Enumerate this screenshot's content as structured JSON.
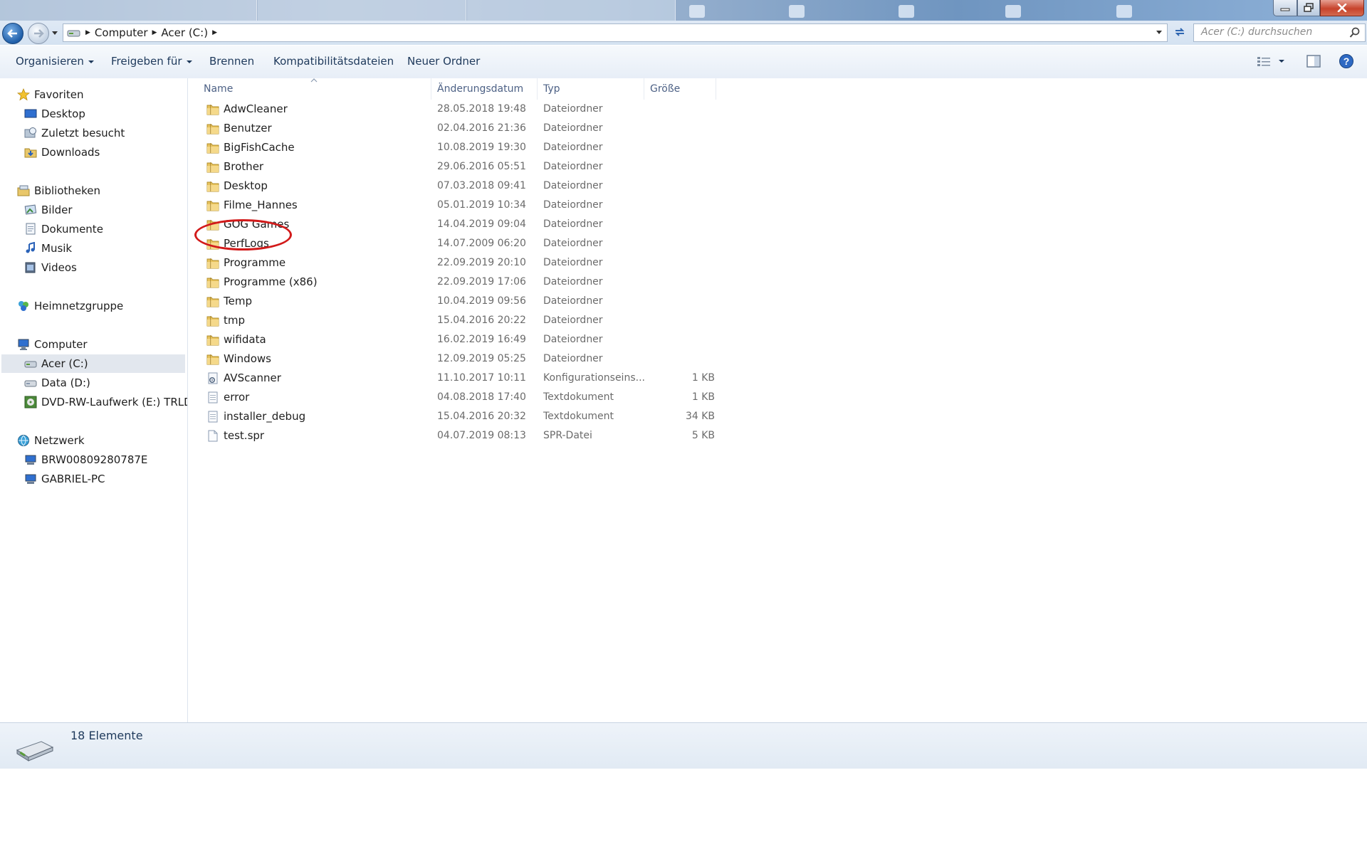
{
  "window": {
    "minimize_icon": "minimize-icon",
    "maximize_icon": "maximize-icon",
    "close_icon": "close-icon"
  },
  "address": {
    "crumbs": [
      "Computer",
      "Acer (C:)"
    ],
    "search_placeholder": "Acer (C:) durchsuchen"
  },
  "toolbar": {
    "organize": "Organisieren",
    "share": "Freigeben für",
    "burn": "Brennen",
    "compat": "Kompatibilitätsdateien",
    "new_folder": "Neuer Ordner"
  },
  "sidebar": {
    "favorites": "Favoriten",
    "fav_items": [
      "Desktop",
      "Zuletzt besucht",
      "Downloads"
    ],
    "libraries": "Bibliotheken",
    "lib_items": [
      "Bilder",
      "Dokumente",
      "Musik",
      "Videos"
    ],
    "homegroup": "Heimnetzgruppe",
    "computer": "Computer",
    "drives": [
      "Acer (C:)",
      "Data (D:)",
      "DVD-RW-Laufwerk (E:) TRLD_D"
    ],
    "network": "Netzwerk",
    "net_items": [
      "BRW00809280787E",
      "GABRIEL-PC"
    ]
  },
  "columns": {
    "name": "Name",
    "date": "Änderungsdatum",
    "type": "Typ",
    "size": "Größe"
  },
  "files": [
    {
      "name": "AdwCleaner",
      "date": "28.05.2018 19:48",
      "type": "Dateiordner",
      "size": "",
      "icon": "folder-icon"
    },
    {
      "name": "Benutzer",
      "date": "02.04.2016 21:36",
      "type": "Dateiordner",
      "size": "",
      "icon": "folder-icon"
    },
    {
      "name": "BigFishCache",
      "date": "10.08.2019 19:30",
      "type": "Dateiordner",
      "size": "",
      "icon": "folder-icon"
    },
    {
      "name": "Brother",
      "date": "29.06.2016 05:51",
      "type": "Dateiordner",
      "size": "",
      "icon": "folder-icon"
    },
    {
      "name": "Desktop",
      "date": "07.03.2018 09:41",
      "type": "Dateiordner",
      "size": "",
      "icon": "folder-icon"
    },
    {
      "name": "Filme_Hannes",
      "date": "05.01.2019 10:34",
      "type": "Dateiordner",
      "size": "",
      "icon": "folder-icon"
    },
    {
      "name": "GOG Games",
      "date": "14.04.2019 09:04",
      "type": "Dateiordner",
      "size": "",
      "icon": "folder-icon"
    },
    {
      "name": "PerfLogs",
      "date": "14.07.2009 06:20",
      "type": "Dateiordner",
      "size": "",
      "icon": "folder-icon"
    },
    {
      "name": "Programme",
      "date": "22.09.2019 20:10",
      "type": "Dateiordner",
      "size": "",
      "icon": "folder-icon"
    },
    {
      "name": "Programme (x86)",
      "date": "22.09.2019 17:06",
      "type": "Dateiordner",
      "size": "",
      "icon": "folder-icon"
    },
    {
      "name": "Temp",
      "date": "10.04.2019 09:56",
      "type": "Dateiordner",
      "size": "",
      "icon": "folder-icon"
    },
    {
      "name": "tmp",
      "date": "15.04.2016 20:22",
      "type": "Dateiordner",
      "size": "",
      "icon": "folder-icon"
    },
    {
      "name": "wifidata",
      "date": "16.02.2019 16:49",
      "type": "Dateiordner",
      "size": "",
      "icon": "folder-icon"
    },
    {
      "name": "Windows",
      "date": "12.09.2019 05:25",
      "type": "Dateiordner",
      "size": "",
      "icon": "folder-icon"
    },
    {
      "name": "AVScanner",
      "date": "11.10.2017 10:11",
      "type": "Konfigurationseins...",
      "size": "1 KB",
      "icon": "config-file-icon"
    },
    {
      "name": "error",
      "date": "04.08.2018 17:40",
      "type": "Textdokument",
      "size": "1 KB",
      "icon": "text-file-icon"
    },
    {
      "name": "installer_debug",
      "date": "15.04.2016 20:32",
      "type": "Textdokument",
      "size": "34 KB",
      "icon": "text-file-icon"
    },
    {
      "name": "test.spr",
      "date": "04.07.2019 08:13",
      "type": "SPR-Datei",
      "size": "5 KB",
      "icon": "file-icon"
    }
  ],
  "status": {
    "count": "18 Elemente",
    "icon": "drive-icon"
  },
  "colors": {
    "annotation": "#d21a1a",
    "selection": "#e2e7ee"
  }
}
